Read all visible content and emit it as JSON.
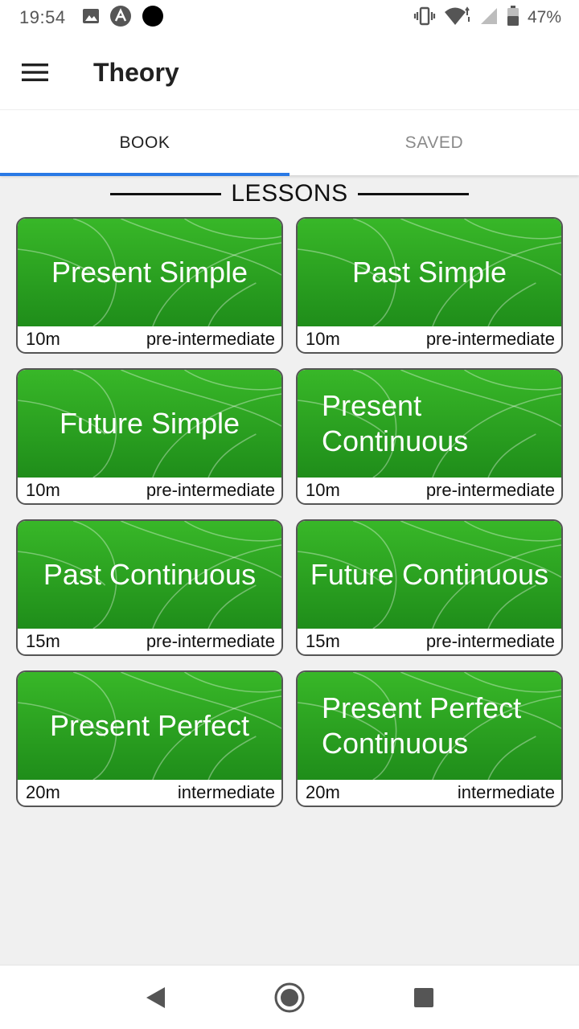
{
  "status_bar": {
    "time": "19:54",
    "left_icons": [
      "image-icon",
      "app-a-icon",
      "dot-icon"
    ],
    "right_icons": [
      "vibrate-icon",
      "wifi-icon",
      "signal-icon",
      "battery-icon"
    ],
    "battery_text": "47%"
  },
  "app_bar": {
    "menu_icon": "hamburger-menu-icon",
    "title": "Theory"
  },
  "tabs": [
    {
      "label": "BOOK",
      "active": true
    },
    {
      "label": "SAVED",
      "active": false
    }
  ],
  "section": {
    "title": "LESSONS"
  },
  "lessons": [
    {
      "title": "Present Simple",
      "duration": "10m",
      "level": "pre-intermediate"
    },
    {
      "title": "Past Simple",
      "duration": "10m",
      "level": "pre-intermediate"
    },
    {
      "title": "Future Simple",
      "duration": "10m",
      "level": "pre-intermediate"
    },
    {
      "title": "Present Continuous",
      "duration": "10m",
      "level": "pre-intermediate"
    },
    {
      "title": "Past Continuous",
      "duration": "15m",
      "level": "pre-intermediate"
    },
    {
      "title": "Future Continuous",
      "duration": "15m",
      "level": "pre-intermediate"
    },
    {
      "title": "Present Perfect",
      "duration": "20m",
      "level": "intermediate"
    },
    {
      "title": "Present Perfect Continuous",
      "duration": "20m",
      "level": "intermediate"
    }
  ],
  "nav_bar": {
    "buttons": [
      "back-icon",
      "home-icon",
      "recents-icon"
    ]
  },
  "colors": {
    "card_green_top": "#38b728",
    "card_green_bottom": "#1f8d1a",
    "tab_indicator": "#2979e5"
  }
}
